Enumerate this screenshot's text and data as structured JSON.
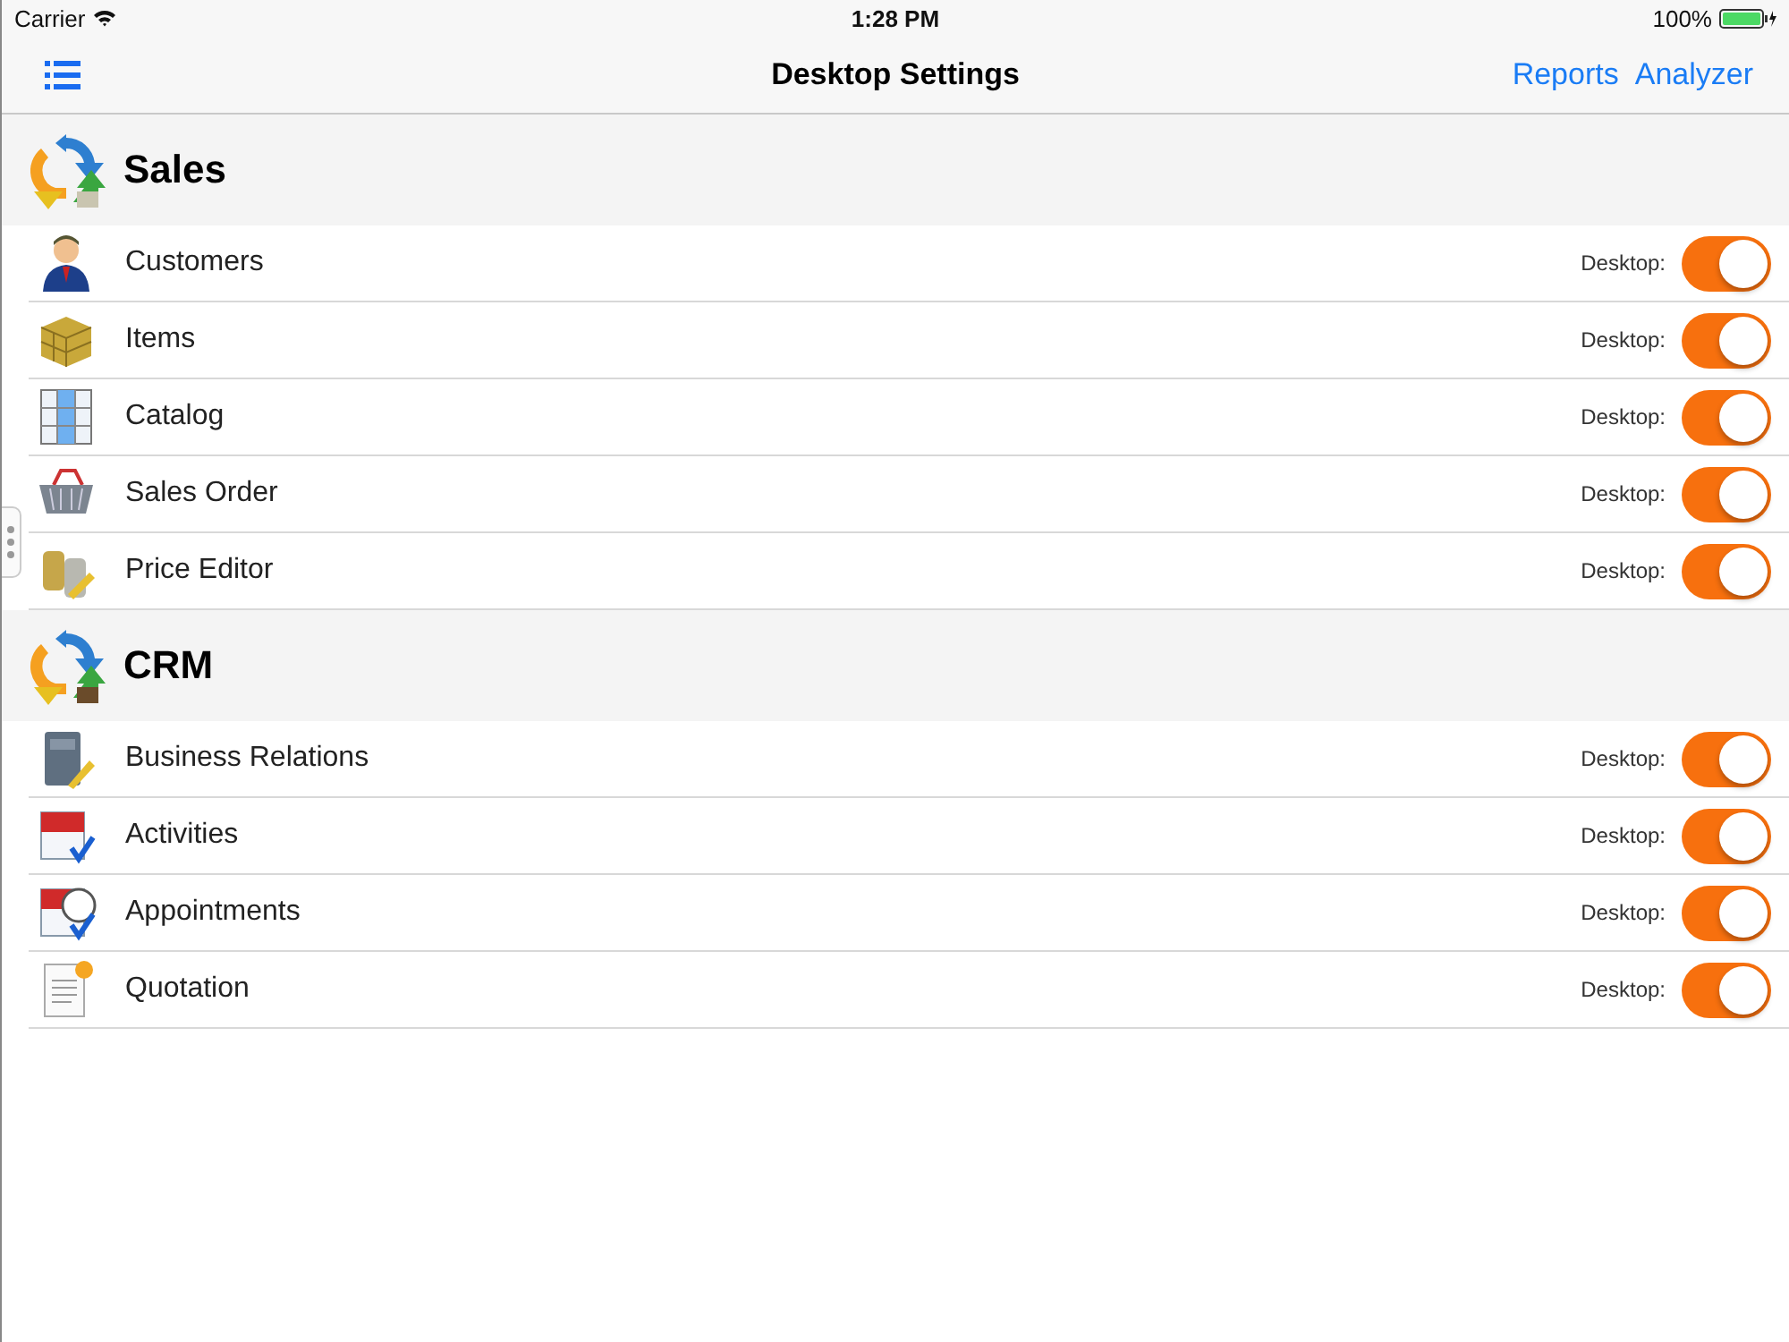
{
  "status_bar": {
    "carrier": "Carrier",
    "time": "1:28 PM",
    "battery": "100%"
  },
  "nav_bar": {
    "title": "Desktop Settings",
    "actions": [
      "Reports",
      "Analyzer"
    ]
  },
  "sections": [
    {
      "title": "Sales",
      "items": [
        {
          "label": "Customers",
          "toggle_label": "Desktop:",
          "on": true
        },
        {
          "label": "Items",
          "toggle_label": "Desktop:",
          "on": true
        },
        {
          "label": "Catalog",
          "toggle_label": "Desktop:",
          "on": true
        },
        {
          "label": "Sales Order",
          "toggle_label": "Desktop:",
          "on": true
        },
        {
          "label": "Price Editor",
          "toggle_label": "Desktop:",
          "on": true
        }
      ]
    },
    {
      "title": "CRM",
      "items": [
        {
          "label": "Business Relations",
          "toggle_label": "Desktop:",
          "on": true
        },
        {
          "label": "Activities",
          "toggle_label": "Desktop:",
          "on": true
        },
        {
          "label": "Appointments",
          "toggle_label": "Desktop:",
          "on": true
        },
        {
          "label": "Quotation",
          "toggle_label": "Desktop:",
          "on": true
        }
      ]
    }
  ]
}
